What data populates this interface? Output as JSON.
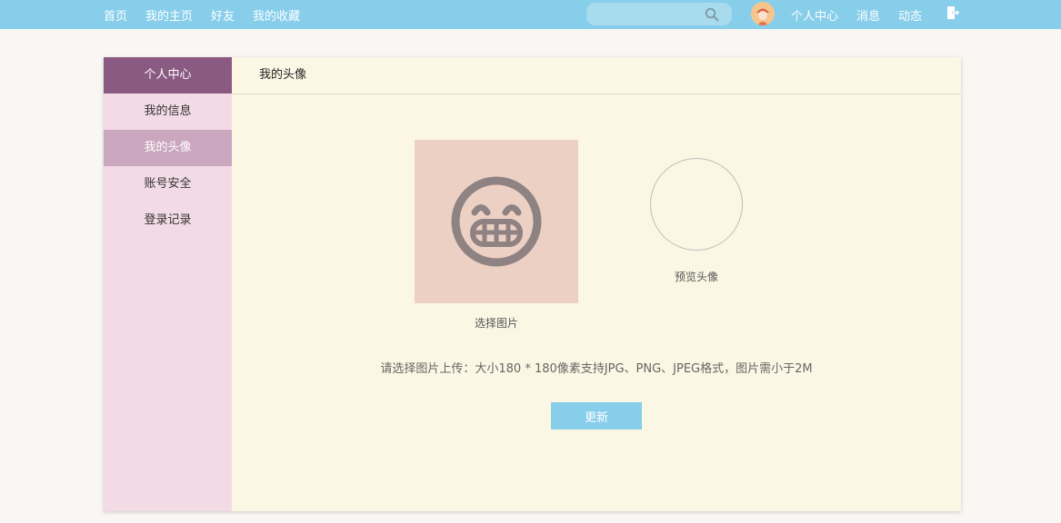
{
  "nav": {
    "left": [
      "首页",
      "我的主页",
      "好友",
      "我的收藏"
    ],
    "search_placeholder": "",
    "right": [
      "个人中心",
      "消息",
      "动态"
    ]
  },
  "sidebar": {
    "title": "个人中心",
    "items": [
      {
        "label": "我的信息",
        "active": false
      },
      {
        "label": "我的头像",
        "active": true
      },
      {
        "label": "账号安全",
        "active": false
      },
      {
        "label": "登录记录",
        "active": false
      }
    ]
  },
  "content": {
    "title": "我的头像",
    "pick_label": "选择图片",
    "preview_label": "预览头像",
    "hint": "请选择图片上传：大小180 * 180像素支持JPG、PNG、JPEG格式，图片需小于2M",
    "update_button": "更新"
  },
  "colors": {
    "topbar": "#87ceeb",
    "sidebar_head": "#8b5a82",
    "sidebar_active": "#caa6bf",
    "sidebar_bg": "#f3dbe6",
    "content_bg": "#fbf7e4"
  },
  "icons": [
    "search-icon",
    "user-avatar",
    "logout-icon",
    "grin-face-icon"
  ]
}
